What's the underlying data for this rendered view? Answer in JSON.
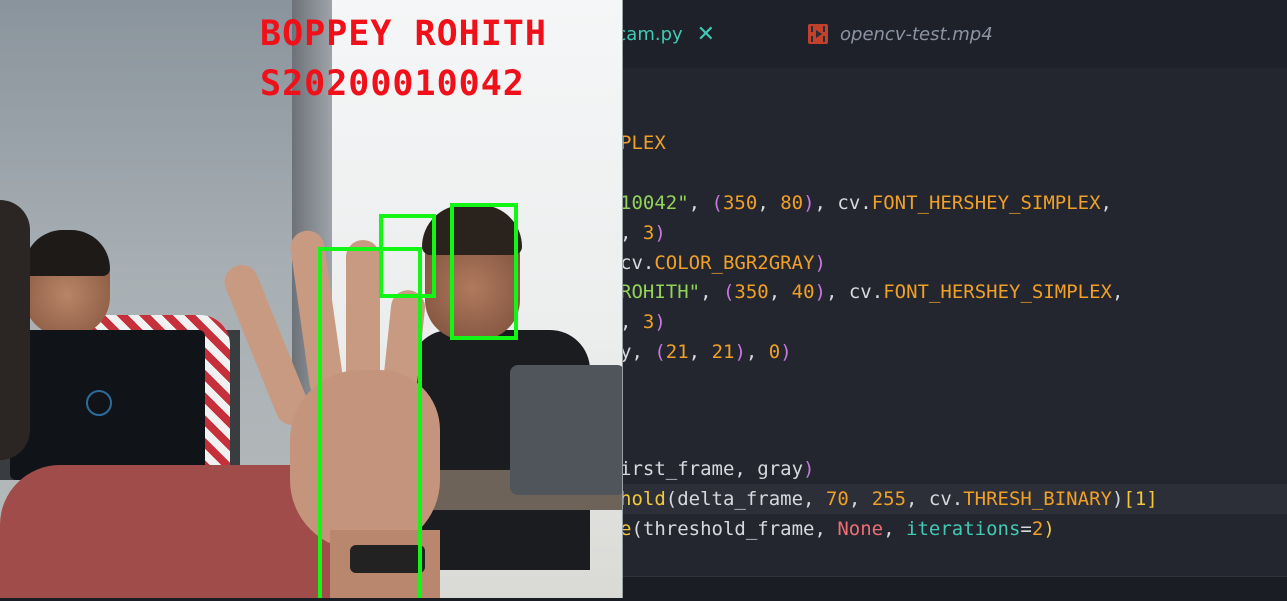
{
  "editor": {
    "tabs": [
      {
        "label": "g Webcam.py",
        "close": "✕"
      },
      {
        "label": "opencv-test.mp4"
      }
    ],
    "code_lines": [
      [
        {
          "t": "PLEX",
          "c": "o"
        }
      ],
      [
        {
          "t": "10042\"",
          "c": "g"
        },
        {
          "t": ", ",
          "c": "w"
        },
        {
          "t": "(",
          "c": "p"
        },
        {
          "t": "350",
          "c": "o"
        },
        {
          "t": ", ",
          "c": "w"
        },
        {
          "t": "80",
          "c": "o"
        },
        {
          "t": ")",
          "c": "p"
        },
        {
          "t": ", cv.",
          "c": "w"
        },
        {
          "t": "FONT_HERSHEY_SIMPLEX",
          "c": "o"
        },
        {
          "t": ",",
          "c": "w"
        }
      ],
      [
        {
          "t": ", ",
          "c": "w"
        },
        {
          "t": "3",
          "c": "o"
        },
        {
          "t": ")",
          "c": "p"
        }
      ],
      [
        {
          "t": "cv.",
          "c": "w"
        },
        {
          "t": "COLOR_BGR2GRAY",
          "c": "o"
        },
        {
          "t": ")",
          "c": "p"
        }
      ],
      [
        {
          "t": "ROHITH\"",
          "c": "g"
        },
        {
          "t": ", ",
          "c": "w"
        },
        {
          "t": "(",
          "c": "p"
        },
        {
          "t": "350",
          "c": "o"
        },
        {
          "t": ", ",
          "c": "w"
        },
        {
          "t": "40",
          "c": "o"
        },
        {
          "t": ")",
          "c": "p"
        },
        {
          "t": ", cv.",
          "c": "w"
        },
        {
          "t": "FONT_HERSHEY_SIMPLEX",
          "c": "o"
        },
        {
          "t": ",",
          "c": "w"
        }
      ],
      [
        {
          "t": ", ",
          "c": "w"
        },
        {
          "t": "3",
          "c": "o"
        },
        {
          "t": ")",
          "c": "p"
        }
      ],
      [
        {
          "t": "y, ",
          "c": "w"
        },
        {
          "t": "(",
          "c": "p"
        },
        {
          "t": "21",
          "c": "o"
        },
        {
          "t": ", ",
          "c": "w"
        },
        {
          "t": "21",
          "c": "o"
        },
        {
          "t": ")",
          "c": "p"
        },
        {
          "t": ", ",
          "c": "w"
        },
        {
          "t": "0",
          "c": "o"
        },
        {
          "t": ")",
          "c": "p"
        }
      ],
      [
        {
          "t": "irst_frame, gray",
          "c": "w"
        },
        {
          "t": ")",
          "c": "p"
        }
      ],
      [
        {
          "t": "hold",
          "c": "y"
        },
        {
          "t": "(delta_frame, ",
          "c": "w"
        },
        {
          "t": "70",
          "c": "o"
        },
        {
          "t": ", ",
          "c": "w"
        },
        {
          "t": "255",
          "c": "o"
        },
        {
          "t": ", cv.",
          "c": "w"
        },
        {
          "t": "THRESH_BINARY",
          "c": "o"
        },
        {
          "t": ")",
          "c": "w"
        },
        {
          "t": "[1]",
          "c": "y"
        }
      ],
      [
        {
          "t": "e",
          "c": "y"
        },
        {
          "t": "(threshold_frame, ",
          "c": "w"
        },
        {
          "t": "None",
          "c": "r"
        },
        {
          "t": ", ",
          "c": "w"
        },
        {
          "t": "iterations",
          "c": "c"
        },
        {
          "t": "=",
          "c": "w"
        },
        {
          "t": "2",
          "c": "o"
        },
        {
          "t": ")",
          "c": "y"
        }
      ]
    ]
  },
  "webcam": {
    "overlay_name": "BOPPEY ROHITH",
    "overlay_id": "S20200010042",
    "box_color": "#13f514",
    "text_color": "#f0101a"
  },
  "colors": {
    "editor_bg": "#23262f",
    "active_tab": "#41c9b4"
  }
}
